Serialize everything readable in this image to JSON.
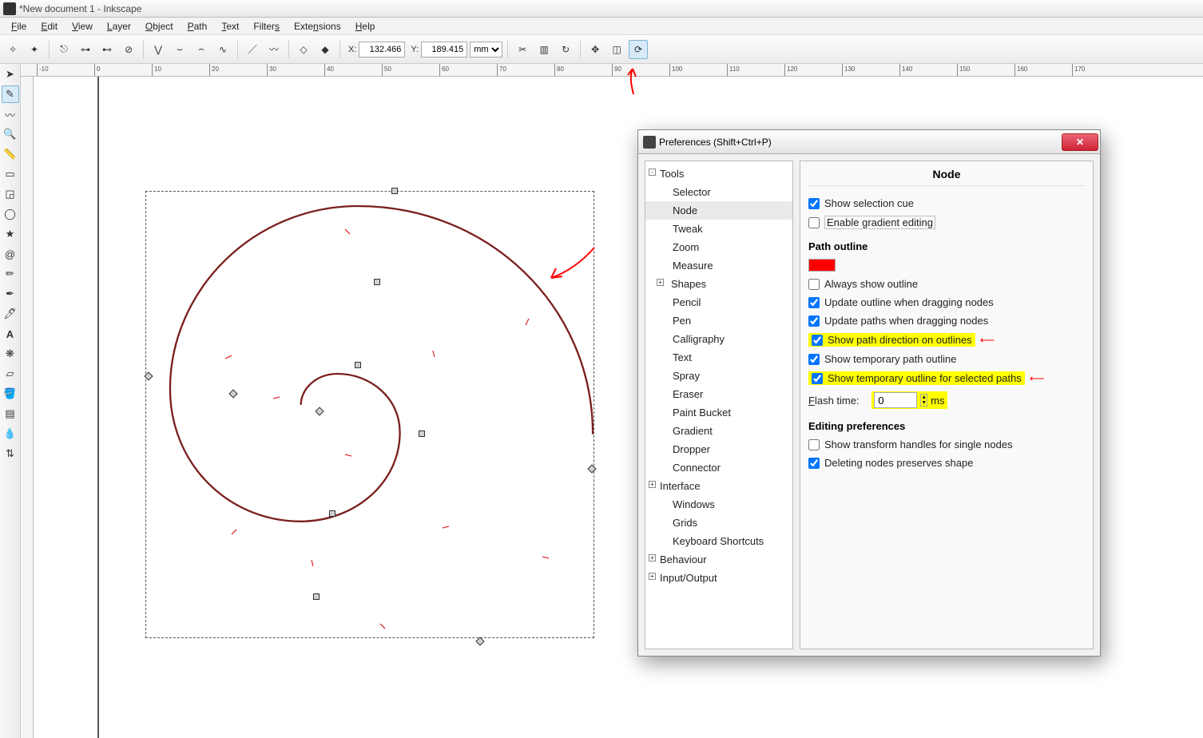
{
  "titlebar": {
    "title": "*New document 1 - Inkscape"
  },
  "menus": [
    "File",
    "Edit",
    "View",
    "Layer",
    "Object",
    "Path",
    "Text",
    "Filters",
    "Extensions",
    "Help"
  ],
  "toolbar": {
    "x_label": "X:",
    "x_value": "132.466",
    "y_label": "Y:",
    "y_value": "189.415",
    "unit": "mm"
  },
  "ruler": {
    "marks": [
      "-10",
      "0",
      "10",
      "20",
      "30",
      "40",
      "50",
      "60",
      "70",
      "80",
      "90",
      "100",
      "110",
      "120",
      "130",
      "140",
      "150",
      "160",
      "170"
    ]
  },
  "preferences": {
    "title": "Preferences (Shift+Ctrl+P)",
    "tree": [
      {
        "label": "Tools",
        "tw": "-",
        "lvl": 0
      },
      {
        "label": "Selector",
        "lvl": 1
      },
      {
        "label": "Node",
        "lvl": 1,
        "sel": true
      },
      {
        "label": "Tweak",
        "lvl": 1
      },
      {
        "label": "Zoom",
        "lvl": 1
      },
      {
        "label": "Measure",
        "lvl": 1
      },
      {
        "label": "Shapes",
        "tw": "+",
        "lvl": 1
      },
      {
        "label": "Pencil",
        "lvl": 1
      },
      {
        "label": "Pen",
        "lvl": 1
      },
      {
        "label": "Calligraphy",
        "lvl": 1
      },
      {
        "label": "Text",
        "lvl": 1
      },
      {
        "label": "Spray",
        "lvl": 1
      },
      {
        "label": "Eraser",
        "lvl": 1
      },
      {
        "label": "Paint Bucket",
        "lvl": 1
      },
      {
        "label": "Gradient",
        "lvl": 1
      },
      {
        "label": "Dropper",
        "lvl": 1
      },
      {
        "label": "Connector",
        "lvl": 1
      },
      {
        "label": "Interface",
        "tw": "+",
        "lvl": 0
      },
      {
        "label": "Windows",
        "lvl": 1
      },
      {
        "label": "Grids",
        "lvl": 1
      },
      {
        "label": "Keyboard Shortcuts",
        "lvl": 1
      },
      {
        "label": "Behaviour",
        "tw": "+",
        "lvl": 0
      },
      {
        "label": "Input/Output",
        "tw": "+",
        "lvl": 0
      }
    ],
    "panel": {
      "title": "Node",
      "show_selection_cue": "Show selection cue",
      "enable_gradient_editing": "Enable gradient editing",
      "path_outline": "Path outline",
      "always_show_outline": "Always show outline",
      "update_outline_dragging": "Update outline when dragging nodes",
      "update_paths_dragging": "Update paths when dragging nodes",
      "show_path_direction": "Show path direction on outlines",
      "show_temp_outline": "Show temporary path outline",
      "show_temp_outline_selected": "Show temporary outline for selected paths",
      "flash_label": "Flash time:",
      "flash_value": "0",
      "flash_unit": "ms",
      "editing_prefs": "Editing preferences",
      "show_transform_handles": "Show transform handles for single nodes",
      "deleting_preserves": "Deleting nodes preserves shape"
    }
  }
}
